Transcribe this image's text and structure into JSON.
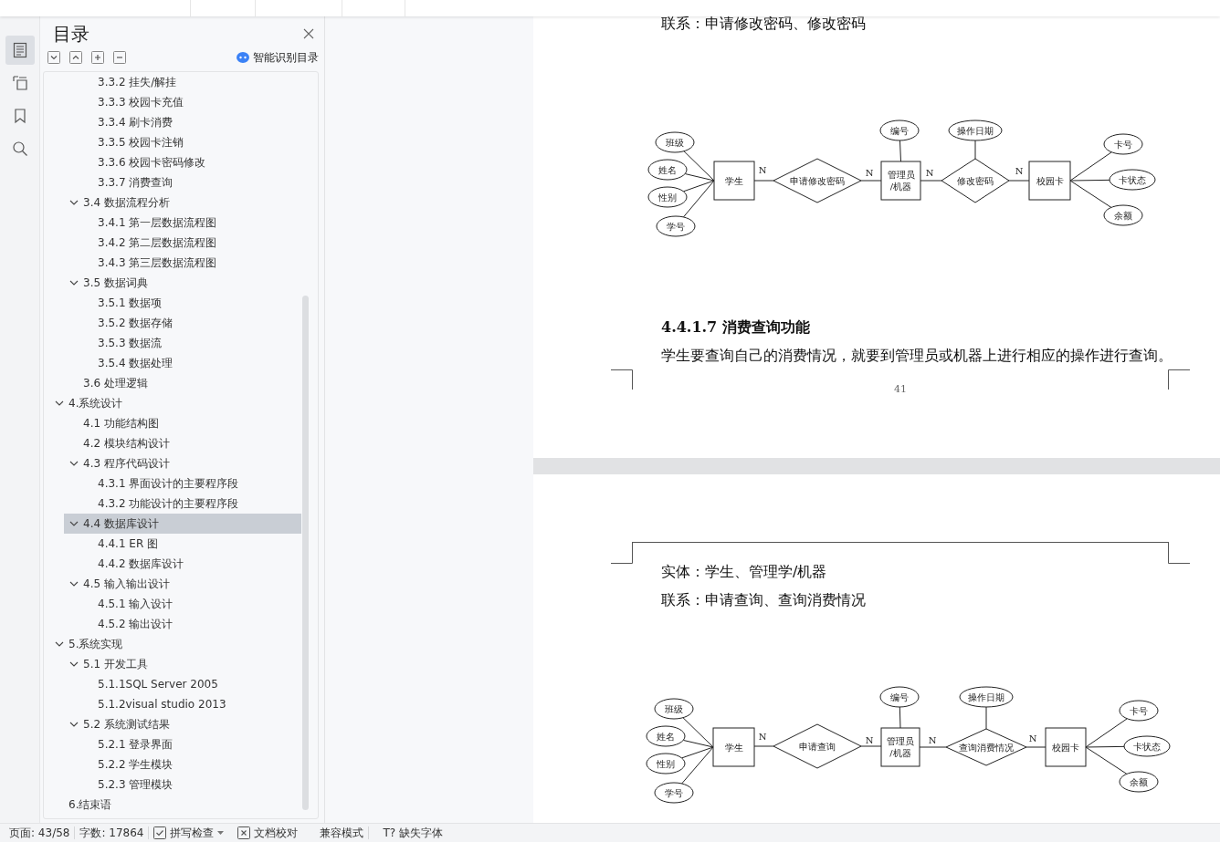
{
  "rail": [
    {
      "kind": "outline",
      "selected": true
    },
    {
      "kind": "tree",
      "selected": false
    },
    {
      "kind": "bookmark",
      "selected": false
    },
    {
      "kind": "search",
      "selected": false
    }
  ],
  "sidebar": {
    "title": "目录",
    "tools": [
      {
        "kind": "expand"
      },
      {
        "kind": "collapse"
      },
      {
        "kind": "add"
      },
      {
        "kind": "remove"
      }
    ],
    "smart_button": "智能识别目录",
    "toc": [
      {
        "children": [
          {
            "children": [
              {
                "label": "3.3.2 挂失/解挂",
                "selected": false
              },
              {
                "label": "3.3.3 校园卡充值",
                "selected": false
              },
              {
                "label": "3.3.4 刷卡消费",
                "selected": false
              },
              {
                "label": "3.3.5 校园卡注销",
                "selected": false
              },
              {
                "label": "3.3.6 校园卡密码修改",
                "selected": false
              },
              {
                "label": "3.3.7 消费查询",
                "selected": false
              }
            ]
          },
          {
            "label": "3.4 数据流程分析",
            "selected": false,
            "expanded": true,
            "children": [
              {
                "label": "3.4.1 第一层数据流程图",
                "selected": false
              },
              {
                "label": "3.4.2 第二层数据流程图",
                "selected": false
              },
              {
                "label": "3.4.3 第三层数据流程图",
                "selected": false
              }
            ]
          },
          {
            "label": "3.5 数据词典",
            "selected": false,
            "expanded": true,
            "children": [
              {
                "label": "3.5.1 数据项",
                "selected": false
              },
              {
                "label": "3.5.2 数据存储",
                "selected": false
              },
              {
                "label": "3.5.3  数据流",
                "selected": false
              },
              {
                "label": "3.5.4 数据处理",
                "selected": false
              }
            ]
          },
          {
            "label": "3.6 处理逻辑",
            "selected": false
          }
        ]
      },
      {
        "label": "4.系统设计",
        "selected": false,
        "expanded": true,
        "children": [
          {
            "label": "4.1 功能结构图",
            "selected": false
          },
          {
            "label": "4.2 模块结构设计",
            "selected": false
          },
          {
            "label": "4.3 程序代码设计",
            "selected": false,
            "expanded": true,
            "children": [
              {
                "label": "4.3.1 界面设计的主要程序段",
                "selected": false
              },
              {
                "label": "4.3.2 功能设计的主要程序段",
                "selected": false
              }
            ]
          },
          {
            "label": "4.4 数据库设计",
            "selected": true,
            "expanded": true,
            "children": [
              {
                "label": "4.4.1 ER 图",
                "selected": false
              },
              {
                "label": "4.4.2 数据库设计",
                "selected": false
              }
            ]
          },
          {
            "label": "4.5 输入输出设计",
            "selected": false,
            "expanded": true,
            "children": [
              {
                "label": "4.5.1 输入设计",
                "selected": false
              },
              {
                "label": "4.5.2 输出设计",
                "selected": false
              }
            ]
          }
        ]
      },
      {
        "label": "5.系统实现",
        "selected": false,
        "expanded": true,
        "children": [
          {
            "label": "5.1 开发工具",
            "selected": false,
            "expanded": true,
            "children": [
              {
                "label": "5.1.1SQL Server 2005",
                "selected": false
              },
              {
                "label": "5.1.2visual studio 2013",
                "selected": false
              }
            ]
          },
          {
            "label": "5.2 系统测试结果",
            "selected": false,
            "expanded": true,
            "children": [
              {
                "label": "5.2.1 登录界面",
                "selected": false
              },
              {
                "label": "5.2.2 学生模块",
                "selected": false
              },
              {
                "label": "5.2.3 管理模块",
                "selected": false
              }
            ]
          }
        ]
      },
      {
        "label": "6.结束语",
        "selected": false
      }
    ]
  },
  "document": {
    "pages": [
      {
        "blocks": [
          {
            "kind": "text",
            "text": "联系：申请修改密码、修改密码"
          },
          {
            "kind": "er_diagram",
            "entities": [
              {
                "lines": [
                  "学生"
                ],
                "attributes": [
                  "班级",
                  "姓名",
                  "性别",
                  "学号"
                ]
              },
              {
                "lines": [
                  "管理员",
                  "/机器"
                ],
                "attributes": [
                  "编号"
                ]
              },
              {
                "lines": [
                  "校园卡"
                ],
                "attributes": [
                  "卡号",
                  "卡状态",
                  "余额"
                ]
              }
            ],
            "relationships": [
              {
                "label": "申请修改密码"
              },
              {
                "label": "修改密码",
                "attributes": [
                  "操作日期"
                ]
              }
            ],
            "cardinalities": [
              "N",
              "N",
              "N",
              "N"
            ]
          },
          {
            "kind": "heading",
            "text": "4.4.1.7 消费查询功能"
          },
          {
            "kind": "text",
            "text": "学生要查询自己的消费情况，就要到管理员或机器上进行相应的操作进行查询。"
          }
        ],
        "page_number": "41"
      },
      {
        "blocks": [
          {
            "kind": "text",
            "text": "实体：学生、管理学/机器"
          },
          {
            "kind": "text",
            "text": "联系：申请查询、查询消费情况"
          },
          {
            "kind": "er_diagram",
            "entities": [
              {
                "lines": [
                  "学生"
                ],
                "attributes": [
                  "班级",
                  "姓名",
                  "性别",
                  "学号"
                ]
              },
              {
                "lines": [
                  "管理员",
                  "/机器"
                ],
                "attributes": [
                  "编号"
                ]
              },
              {
                "lines": [
                  "校园卡"
                ],
                "attributes": [
                  "卡号",
                  "卡状态",
                  "余额"
                ]
              }
            ],
            "relationships": [
              {
                "label": "申请查询"
              },
              {
                "label": "查询消费情况",
                "attributes": [
                  "操作日期"
                ]
              }
            ],
            "cardinalities": [
              "N",
              "N",
              "N",
              "N"
            ]
          }
        ]
      }
    ]
  },
  "status_bar": [
    {
      "kind": "text",
      "label": "页面: 43/58"
    },
    {
      "kind": "text",
      "label": "字数: 17864"
    },
    {
      "kind": "spell",
      "label": "拼写检查"
    },
    {
      "kind": "proof",
      "label": "文档校对"
    },
    {
      "kind": "text",
      "label": "兼容模式"
    },
    {
      "kind": "font",
      "glyph": "T?",
      "label": "缺失字体"
    }
  ]
}
